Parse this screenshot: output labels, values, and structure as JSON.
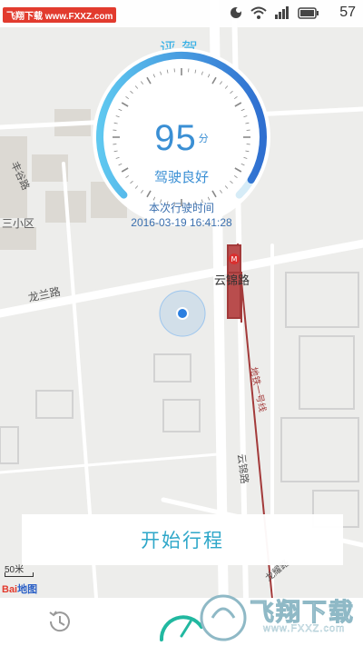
{
  "status_bar": {
    "watermark": "飞翔下载 www.FXXZ.com",
    "time": "57"
  },
  "rating": {
    "title": "评驾",
    "score": "95",
    "score_unit": "分",
    "score_fill": 0.95,
    "label": "驾驶良好",
    "trip_time_label": "本次行驶时间",
    "trip_time": "2016-03-19 16:41:28"
  },
  "map": {
    "labels": {
      "road_longlan": "龙兰路",
      "road_feng": "丰谷路",
      "area_xiaoqu": "三小区",
      "station": "云锦路",
      "road_yunjin": "云锦路",
      "metro": "地铁一号线",
      "road_longyao": "龙耀路"
    },
    "scale": "50米",
    "logo": "Bai",
    "logo_suffix": "地图"
  },
  "actions": {
    "start_trip": "开始行程"
  },
  "tabbar": {
    "items": [
      {
        "name": "history",
        "icon": "clock-history-icon"
      },
      {
        "name": "drive",
        "icon": "speedometer-icon"
      },
      {
        "name": "profile",
        "icon": "profile-icon"
      }
    ]
  },
  "watermark_brand": {
    "text": "飞翔下载",
    "url": "www.FXXZ.com"
  },
  "colors": {
    "accent": "#35b0e6",
    "gauge_start": "#5fc8f0",
    "gauge_end": "#2f6fd0",
    "metro_line": "#a33a3a",
    "start_button_text": "#2ea7c9"
  }
}
